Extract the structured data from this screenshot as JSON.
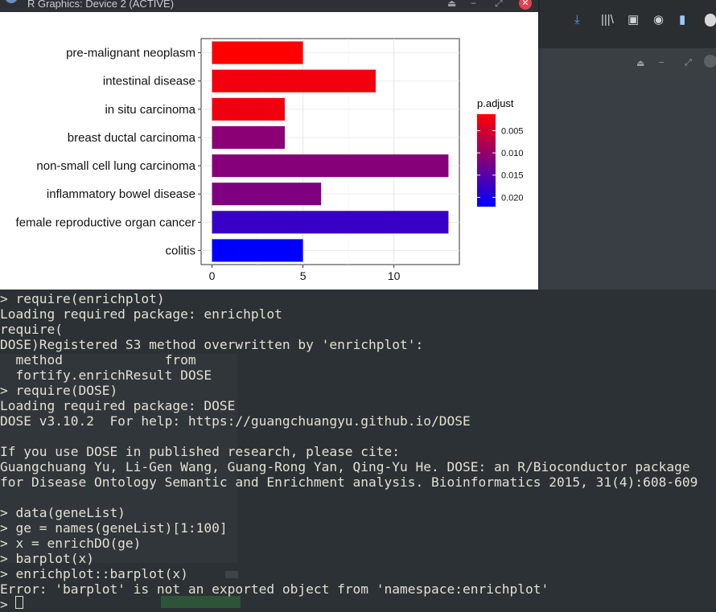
{
  "window": {
    "title": "R Graphics: Device 2 (ACTIVE)"
  },
  "chart_data": {
    "type": "bar",
    "orientation": "horizontal",
    "categories": [
      "pre-malignant neoplasm",
      "intestinal disease",
      "in situ carcinoma",
      "breast ductal carcinoma",
      "non-small cell lung carcinoma",
      "inflammatory bowel disease",
      "female reproductive organ cancer",
      "colitis"
    ],
    "values": [
      5,
      9,
      4,
      4,
      13,
      6,
      13,
      5
    ],
    "p_adjust": [
      0.0013,
      0.0024,
      0.0025,
      0.0108,
      0.0112,
      0.0118,
      0.0175,
      0.0221
    ],
    "xlim": [
      -0.6,
      13.6
    ],
    "xticks": [
      "0",
      "5",
      "10"
    ],
    "xtick_values": [
      0,
      5,
      10
    ],
    "legend": {
      "title": "p.adjust",
      "labels": [
        "0.005",
        "0.010",
        "0.015",
        "0.020"
      ],
      "values": [
        0.005,
        0.01,
        0.015,
        0.02
      ],
      "range": [
        0.0013,
        0.0221
      ],
      "placement": "right"
    },
    "colors": {
      "low": "#ff0000",
      "high": "#0000ff"
    },
    "grid": true
  },
  "console": {
    "lines": [
      "> require(enrichplot)",
      "Loading required package: enrichplot",
      "require(",
      "DOSE)Registered S3 method overwritten by 'enrichplot':",
      "  method             from",
      "  fortify.enrichResult DOSE",
      "> require(DOSE)",
      "Loading required package: DOSE",
      "DOSE v3.10.2  For help: https://guangchuangyu.github.io/DOSE",
      "",
      "If you use DOSE in published research, please cite:",
      "Guangchuang Yu, Li-Gen Wang, Guang-Rong Yan, Qing-Yu He. DOSE: an R/Bioconductor package",
      "for Disease Ontology Semantic and Enrichment analysis. Bioinformatics 2015, 31(4):608-609",
      "",
      "> data(geneList)",
      "> ge = names(geneList)[1:100]",
      "> x = enrichDO(ge)",
      "> barplot(x)",
      "> enrichplot::barplot(x)",
      "Error: 'barplot' is not an exported object from 'namespace:enrichplot'",
      ">"
    ]
  },
  "icons": [
    "download-icon",
    "library-icon",
    "sidebar-icon",
    "account-icon",
    "document-icon"
  ],
  "colors": {
    "console_bg": "#2b3134",
    "console_text": "#e3e0d2",
    "close_button": "#e0424f"
  }
}
